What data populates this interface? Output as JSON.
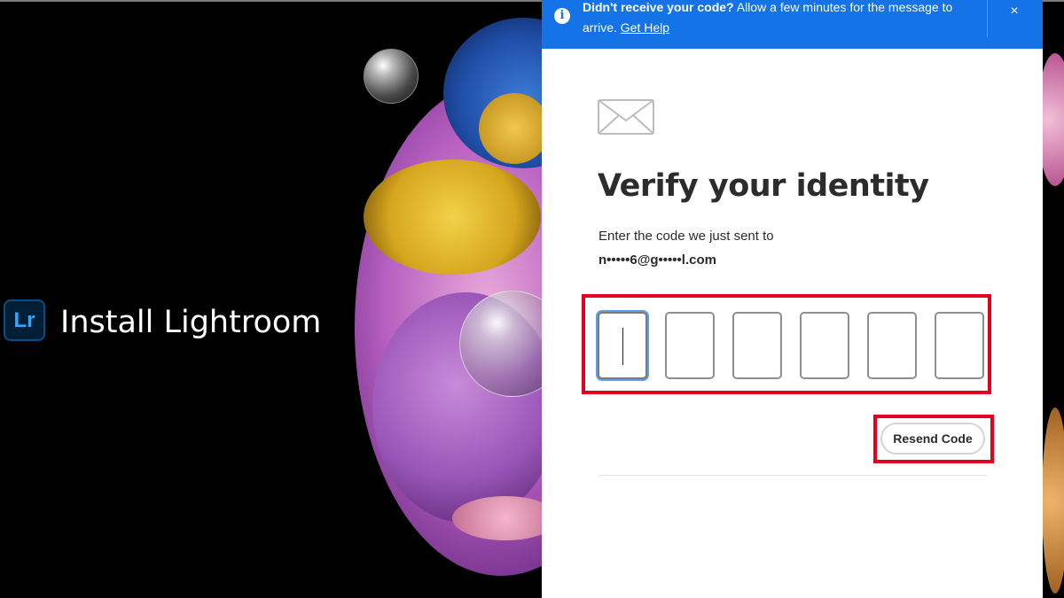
{
  "app": {
    "title": "Install Lightroom",
    "logo_text": "Lr"
  },
  "banner": {
    "message_bold": "Didn't receive your code?",
    "message_rest": " Allow a few minutes for the message to arrive. ",
    "link": "Get Help",
    "close": "×",
    "info_glyph": "i"
  },
  "dialog": {
    "heading": "Verify your identity",
    "instruction": "Enter the code we just sent to",
    "email": "n•••••6@g•••••l.com",
    "code_digits": [
      "",
      "",
      "",
      "",
      "",
      ""
    ],
    "resend_label": "Resend Code"
  },
  "icons": [
    "info-icon",
    "close-icon",
    "mail-icon",
    "lightroom-logo"
  ],
  "colors": {
    "banner": "#1473e6",
    "highlight": "#e4001b",
    "logo_bg": "#001e36",
    "logo_text": "#31a8ff"
  }
}
